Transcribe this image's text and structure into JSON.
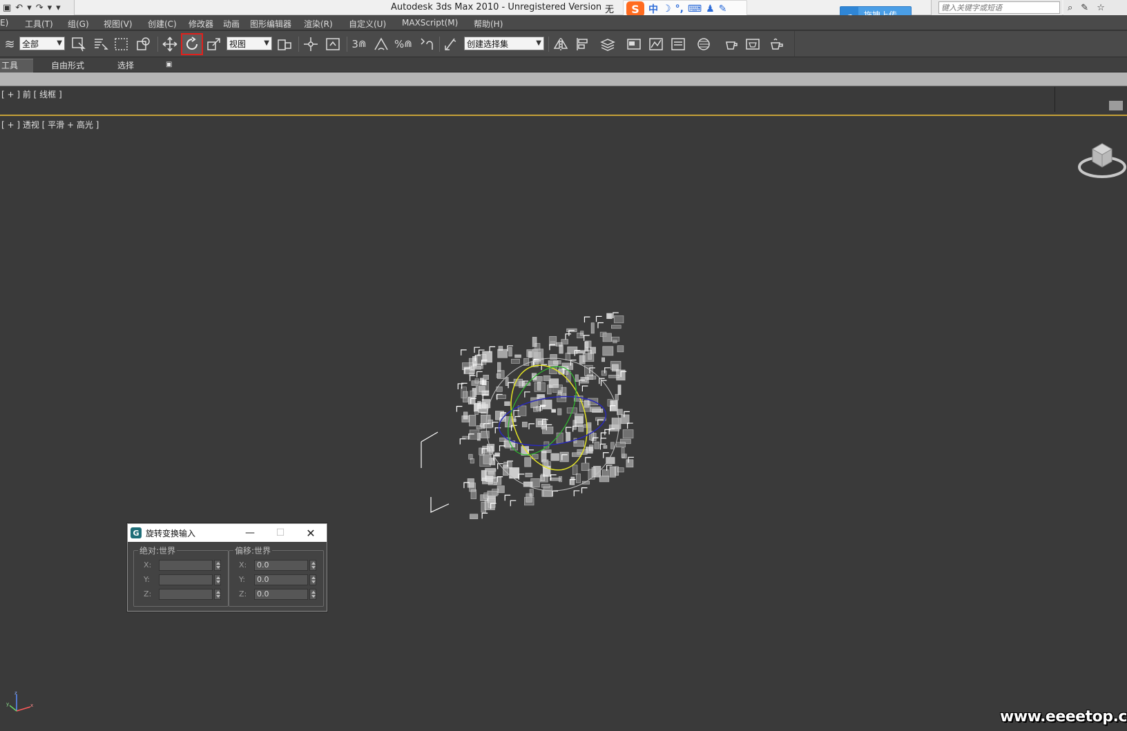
{
  "titlebar": {
    "title": "Autodesk 3ds Max  2010   -  Unregistered Version",
    "title_extra": "无",
    "ime": {
      "items": [
        "中",
        "☽",
        "°,",
        "⌨",
        "♟",
        "✎"
      ]
    },
    "upload_label": "拖拽上传",
    "search_placeholder": "键入关键字或短语"
  },
  "menubar": {
    "items": [
      "E)",
      "工具(T)",
      "组(G)",
      "视图(V)",
      "创建(C)",
      "修改器",
      "动画",
      "图形编辑器",
      "渲染(R)",
      "自定义(U)",
      "MAXScript(M)",
      "帮助(H)"
    ]
  },
  "toolbar": {
    "selection_filter": "全部",
    "reference_coord": "视图",
    "named_selection": "创建选择集",
    "snap_label": "3",
    "percent_label": "%"
  },
  "ribbon": {
    "tabs": [
      "工具",
      "自由形式",
      "选择"
    ]
  },
  "viewports": {
    "front_label": "[ + ] 前 [ 线框 ]",
    "persp_label": "[ + ] 透视 [ 平滑 + 高光 ]"
  },
  "dialog": {
    "title": "旋转变换输入",
    "absolute_label": "绝对:世界",
    "offset_label": "偏移:世界",
    "axes": [
      "X:",
      "Y:",
      "Z:"
    ],
    "absolute_values": [
      "",
      "",
      ""
    ],
    "offset_values": [
      "0.0",
      "0.0",
      "0.0"
    ]
  },
  "watermark": "www.eeeetop.com",
  "colors": {
    "viewport_bg": "#3a3a3a",
    "active_border": "#c7a238",
    "highlight": "#e0201c",
    "upload_blue": "#4a9ee6"
  }
}
